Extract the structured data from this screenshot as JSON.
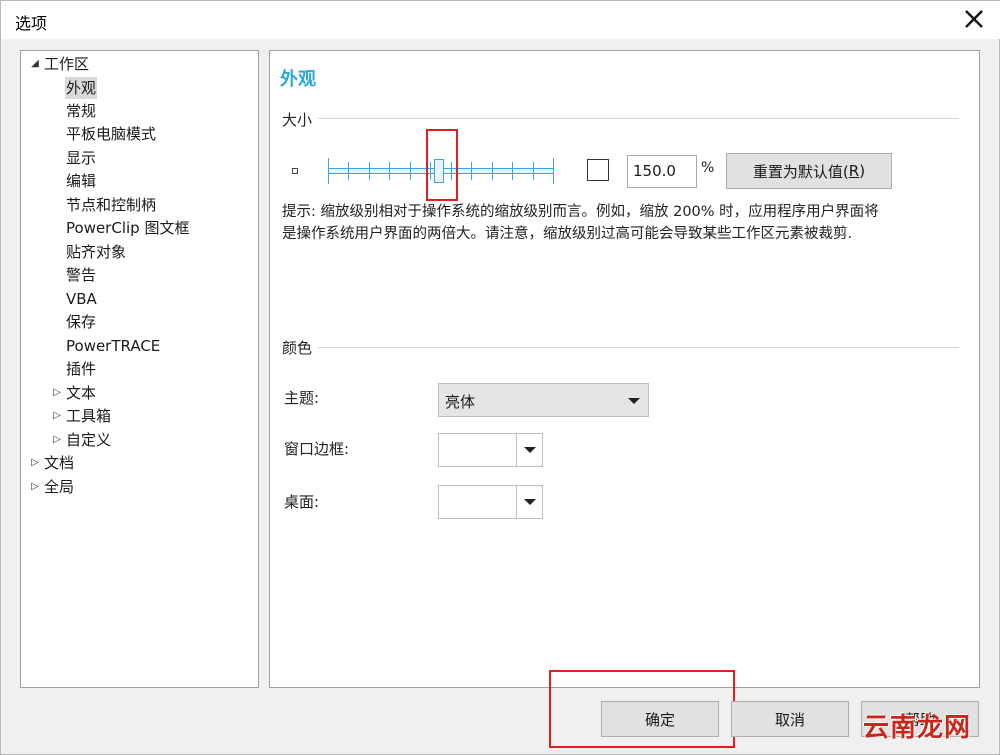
{
  "window": {
    "title": "选项"
  },
  "tree": {
    "items": [
      {
        "label": "工作区",
        "arrow": "◢",
        "selected": false
      },
      {
        "label": "外观",
        "arrow": "",
        "selected": true
      },
      {
        "label": "常规",
        "arrow": "",
        "selected": false
      },
      {
        "label": "平板电脑模式",
        "arrow": "",
        "selected": false
      },
      {
        "label": "显示",
        "arrow": "",
        "selected": false
      },
      {
        "label": "编辑",
        "arrow": "",
        "selected": false
      },
      {
        "label": "节点和控制柄",
        "arrow": "",
        "selected": false
      },
      {
        "label": "PowerClip 图文框",
        "arrow": "",
        "selected": false
      },
      {
        "label": "贴齐对象",
        "arrow": "",
        "selected": false
      },
      {
        "label": "警告",
        "arrow": "",
        "selected": false
      },
      {
        "label": "VBA",
        "arrow": "",
        "selected": false
      },
      {
        "label": "保存",
        "arrow": "",
        "selected": false
      },
      {
        "label": "PowerTRACE",
        "arrow": "",
        "selected": false
      },
      {
        "label": "插件",
        "arrow": "",
        "selected": false
      },
      {
        "label": "文本",
        "arrow": "▷",
        "selected": false
      },
      {
        "label": "工具箱",
        "arrow": "▷",
        "selected": false
      },
      {
        "label": "自定义",
        "arrow": "▷",
        "selected": false
      },
      {
        "label": "文档",
        "arrow": "▷",
        "selected": false
      },
      {
        "label": "全局",
        "arrow": "▷",
        "selected": false
      }
    ]
  },
  "content": {
    "title": "外观",
    "size_group": "大小",
    "scale_value": "150.0",
    "percent_sign": "%",
    "reset_label": "重置为默认值(",
    "reset_mnemonic": "R",
    "reset_close": ")",
    "slider_level": 0.5,
    "hint_line1": "提示: 缩放级别相对于操作系统的缩放级别而言。例如，缩放 200% 时，应用程序用户界面将",
    "hint_line2": "是操作系统用户界面的两倍大。请注意，缩放级别过高可能会导致某些工作区元素被裁剪.",
    "color_group": "颜色",
    "theme_label": "主题:",
    "theme_value": "亮体",
    "window_border_label": "窗口边框:",
    "desktop_label": "桌面:"
  },
  "buttons": {
    "ok": "确定",
    "cancel": "取消",
    "help": "帮助"
  },
  "watermark": "云南龙网",
  "colors": {
    "accent": "#2aa8d8",
    "highlight_box": "#e02020"
  }
}
